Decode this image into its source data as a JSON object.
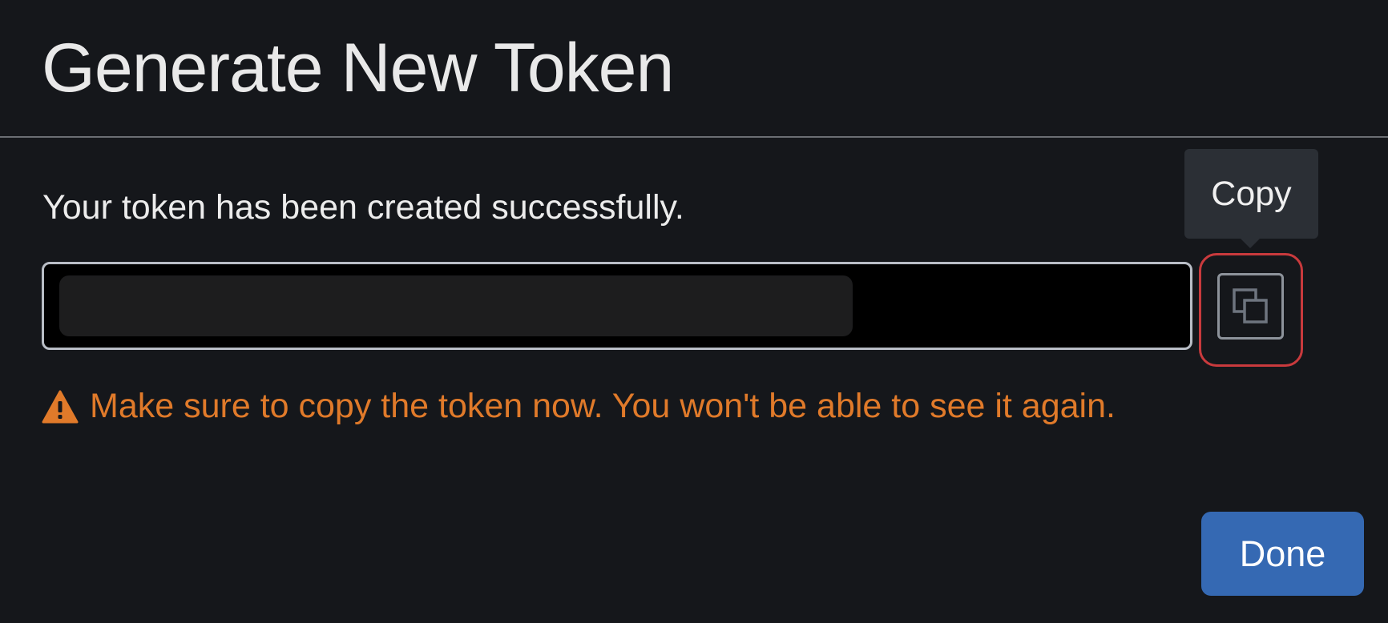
{
  "dialog": {
    "title": "Generate New Token",
    "message": "Your token has been created successfully.",
    "token": {
      "masked": true
    },
    "copy": {
      "icon": "copy-icon",
      "tooltip": "Copy"
    },
    "warning": {
      "icon": "warning-triangle-icon",
      "text": "Make sure to copy the token now. You won't be able to see it again."
    },
    "done_label": "Done"
  },
  "colors": {
    "background": "#15171b",
    "warning": "#e07a2a",
    "primary_button": "#3569b3",
    "highlight_outline": "#c93a3d"
  }
}
